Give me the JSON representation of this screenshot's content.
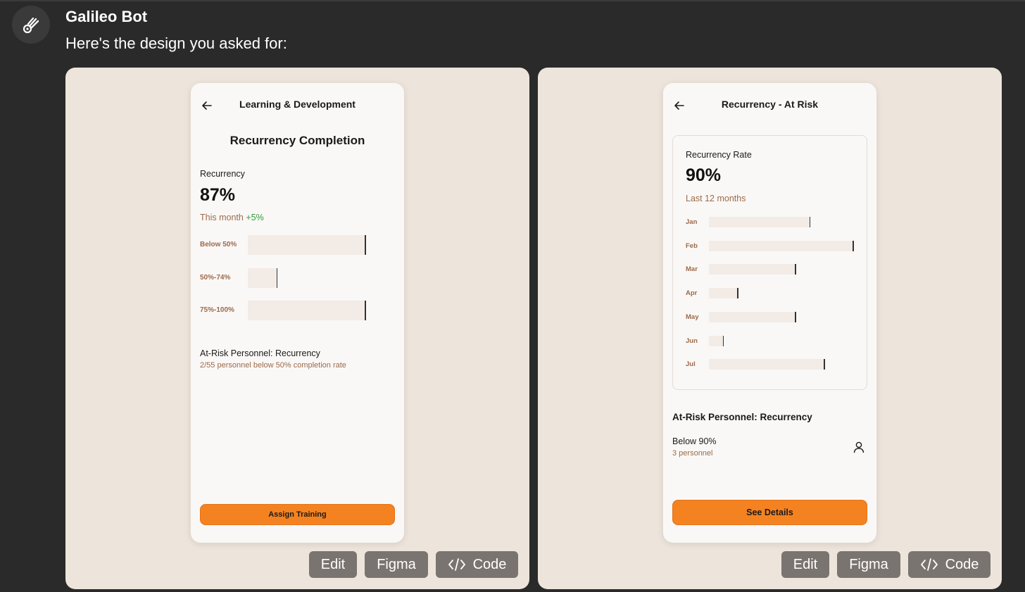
{
  "chat": {
    "bot_name": "Galileo Bot",
    "message": "Here's the design you asked for:",
    "avatar_icon": "galileo-logo-icon"
  },
  "colors": {
    "background": "#2a2a2a",
    "panel": "#ede4db",
    "phone": "#faf8f6",
    "accent_orange": "#f58220",
    "brown_text": "#9b6a4a",
    "positive_green": "#2e9c3c",
    "bar_fill": "#f2ebe6",
    "action_button": "#7a7470"
  },
  "design1": {
    "header_title": "Learning & Development",
    "back_icon": "arrow-left-icon",
    "page_title": "Recurrency Completion",
    "metric_label": "Recurrency",
    "metric_value": "87%",
    "period_label": "This month",
    "change": "+5%",
    "distribution": [
      {
        "label": "Below 50%",
        "value": 1.0
      },
      {
        "label": "50%-74%",
        "value": 0.25
      },
      {
        "label": "75%-100%",
        "value": 1.0
      }
    ],
    "risk_title": "At-Risk Personnel: Recurrency",
    "risk_sub": "2/55 personnel below 50% completion rate",
    "cta_label": "Assign Training"
  },
  "design2": {
    "header_title": "Recurrency - At Risk",
    "back_icon": "arrow-left-icon",
    "card_title": "Recurrency Rate",
    "rate_value": "90%",
    "period": "Last 12 months",
    "months": [
      {
        "label": "Jan",
        "value": 0.7
      },
      {
        "label": "Feb",
        "value": 1.0
      },
      {
        "label": "Mar",
        "value": 0.6
      },
      {
        "label": "Apr",
        "value": 0.2
      },
      {
        "label": "May",
        "value": 0.6
      },
      {
        "label": "Jun",
        "value": 0.1
      },
      {
        "label": "Jul",
        "value": 0.8
      }
    ],
    "section_title": "At-Risk Personnel: Recurrency",
    "item_label": "Below 90%",
    "item_sub": "3 personnel",
    "item_icon": "person-icon",
    "cta_label": "See Details"
  },
  "actions": {
    "edit": "Edit",
    "figma": "Figma",
    "code": "Code",
    "code_icon": "code-brackets-icon"
  }
}
